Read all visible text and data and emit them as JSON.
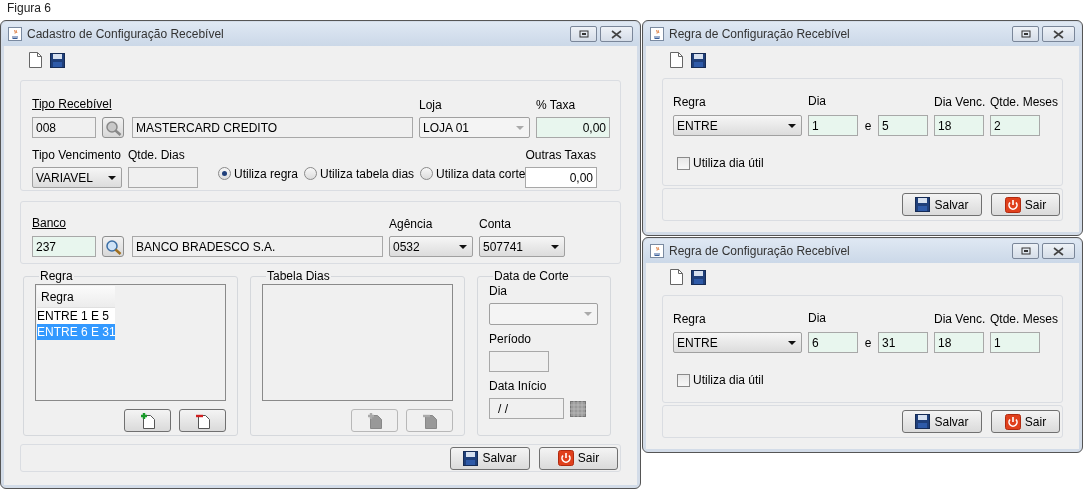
{
  "caption": "Figura 6",
  "main_window": {
    "title": "Cadastro de Configuração Recebível",
    "receivable": {
      "type_label": "Tipo Recebível",
      "code": "008",
      "description": "MASTERCARD CREDITO",
      "store_label": "Loja",
      "store_value": "LOJA 01",
      "store_disabled": true,
      "fee_label": "% Taxa",
      "fee_value": "0,00",
      "due_type_label": "Tipo Vencimento",
      "due_type_value": "VARIAVEL",
      "days_label": "Qtde. Dias",
      "options": [
        {
          "label": "Utiliza regra",
          "selected": true
        },
        {
          "label": "Utiliza tabela dias",
          "selected": false
        },
        {
          "label": "Utiliza data corte",
          "selected": false
        }
      ],
      "other_fees_label": "Outras Taxas",
      "other_fees_value": "0,00"
    },
    "bank": {
      "label": "Banco",
      "code": "237",
      "name": "BANCO BRADESCO S.A.",
      "agency_label": "Agência",
      "agency_value": "0532",
      "account_label": "Conta",
      "account_value": "507741"
    },
    "rule_group": {
      "title": "Regra",
      "column": "Regra",
      "rows": [
        {
          "text": "ENTRE 1 E 5",
          "selected": false
        },
        {
          "text": "ENTRE 6 E 31",
          "selected": true
        }
      ],
      "buttons": [
        {
          "kind": "add",
          "disabled": false
        },
        {
          "kind": "remove",
          "disabled": false
        }
      ]
    },
    "days_table": {
      "title": "Tabela Dias",
      "buttons": [
        {
          "kind": "add",
          "disabled": true
        },
        {
          "kind": "remove",
          "disabled": true
        }
      ]
    },
    "cutoff": {
      "title": "Data de Corte",
      "day_label": "Dia",
      "day_disabled": true,
      "period_label": "Período",
      "start_label": "Data Início",
      "start_value": "/ /"
    },
    "buttons": [
      {
        "kind": "save",
        "label": "Salvar"
      },
      {
        "kind": "exit",
        "label": "Sair"
      }
    ]
  },
  "rule_windows": [
    {
      "title": "Regra de Configuração Recebível",
      "rule_label": "Regra",
      "rule_value": "ENTRE",
      "day_label": "Dia",
      "day_from": "1",
      "connector": "e",
      "day_to": "5",
      "due_day_label": "Dia Venc.",
      "due_day": "18",
      "months_label": "Qtde. Meses",
      "months": "2",
      "checkbox": {
        "label": "Utiliza dia útil",
        "checked": false
      },
      "buttons": [
        {
          "kind": "save",
          "label": "Salvar"
        },
        {
          "kind": "exit",
          "label": "Sair"
        }
      ]
    },
    {
      "title": "Regra de Configuração Recebível",
      "rule_label": "Regra",
      "rule_value": "ENTRE",
      "day_label": "Dia",
      "day_from": "6",
      "connector": "e",
      "day_to": "31",
      "due_day_label": "Dia Venc.",
      "due_day": "18",
      "months_label": "Qtde. Meses",
      "months": "1",
      "checkbox": {
        "label": "Utiliza dia útil",
        "checked": false
      },
      "buttons": [
        {
          "kind": "save",
          "label": "Salvar"
        },
        {
          "kind": "exit",
          "label": "Sair"
        }
      ]
    }
  ]
}
